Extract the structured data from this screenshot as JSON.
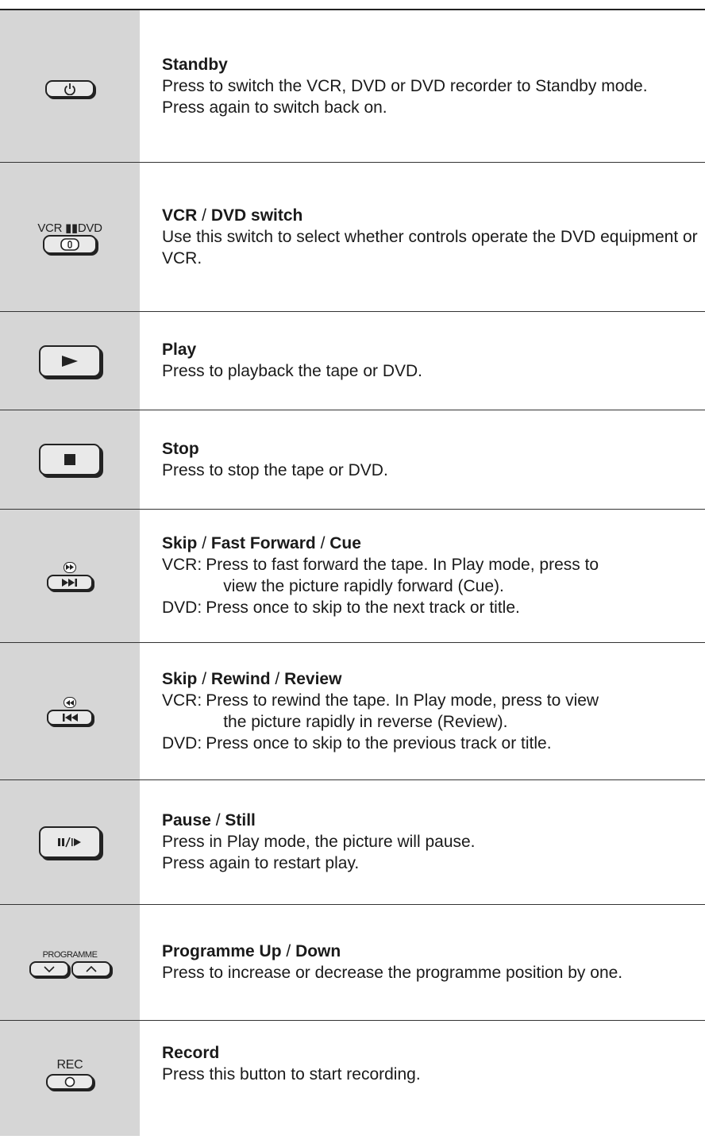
{
  "rows": [
    {
      "icon": "power-icon",
      "title_parts": [
        "Standby"
      ],
      "lines": [
        "Press to switch the VCR, DVD or DVD recorder to Standby mode.",
        "Press again to switch back on."
      ]
    },
    {
      "icon": "vcr-dvd-switch-icon",
      "icon_label": "VCR ▮▮DVD",
      "title_parts": [
        "VCR",
        "DVD switch"
      ],
      "lines": [
        "Use this switch to select whether controls operate the DVD equipment or VCR."
      ]
    },
    {
      "icon": "play-icon",
      "title_parts": [
        "Play"
      ],
      "lines": [
        "Press to playback the tape or DVD."
      ]
    },
    {
      "icon": "stop-icon",
      "title_parts": [
        "Stop"
      ],
      "lines": [
        "Press to stop the tape or DVD."
      ]
    },
    {
      "icon": "skip-forward-icon",
      "title_parts": [
        "Skip",
        "Fast Forward",
        "Cue"
      ],
      "defs": [
        {
          "term": "VCR:",
          "text": "Press to fast forward the tape. In Play mode, press to",
          "cont": "view the picture rapidly forward (Cue)."
        },
        {
          "term": "DVD:",
          "text": "Press once to skip to the next track or title.",
          "cont": ""
        }
      ]
    },
    {
      "icon": "skip-back-icon",
      "title_parts": [
        "Skip",
        "Rewind",
        "Review"
      ],
      "defs": [
        {
          "term": "VCR:",
          "text": "Press to rewind the tape. In Play mode, press to view",
          "cont": "the picture rapidly in reverse (Review)."
        },
        {
          "term": "DVD:",
          "text": "Press once to skip to the previous track or title.",
          "cont": ""
        }
      ]
    },
    {
      "icon": "pause-still-icon",
      "title_parts": [
        "Pause",
        "Still"
      ],
      "lines": [
        "Press in Play mode, the picture will pause.",
        "Press again to restart play."
      ]
    },
    {
      "icon": "programme-up-down-icon",
      "icon_label": "PROGRAMME",
      "title_parts": [
        "Programme Up",
        "Down"
      ],
      "lines": [
        "Press to increase or decrease the programme position by one."
      ]
    },
    {
      "icon": "record-icon",
      "icon_label": "REC",
      "title_parts": [
        "Record"
      ],
      "lines": [
        "Press this button to start recording."
      ]
    }
  ],
  "separator": " / "
}
